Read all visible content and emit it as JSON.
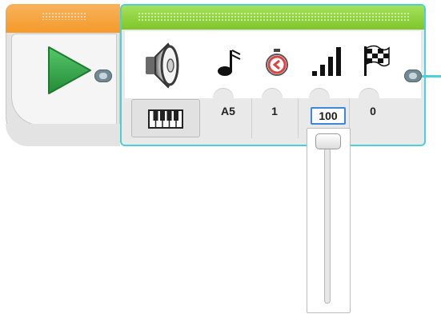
{
  "start_block": {
    "accent_color": "#f59a2a",
    "play_icon": "play-icon",
    "play_color": "#2f9d45"
  },
  "sound_block": {
    "accent_color": "#7fc62a",
    "selection_color": "#4bd0d8",
    "mode_icon": "speaker-icon",
    "param_icons": [
      "note-icon",
      "timer-icon",
      "volume-bars-icon",
      "checkered-flag-icon"
    ],
    "params": {
      "note": "A5",
      "duration": "1",
      "volume": "100",
      "play_type": "0"
    },
    "note_picker_icon": "piano-keys-icon"
  },
  "volume_slider": {
    "value_percent": 100
  }
}
